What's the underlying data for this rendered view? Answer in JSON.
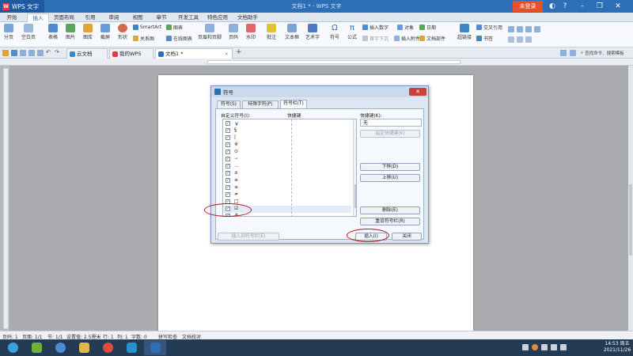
{
  "titlebar": {
    "app_name": "WPS 文字",
    "doc_title": "文档1 * - WPS 文字",
    "login": "未登录"
  },
  "menu": [
    "开始",
    "插入",
    "页面布局",
    "引用",
    "审阅",
    "视图",
    "章节",
    "开发工具",
    "特色应用",
    "文档助手"
  ],
  "ribbon": {
    "large": [
      "分页",
      "空白页",
      "表格",
      "图片",
      "图库",
      "截屏",
      "形状",
      "页眉和页脚",
      "页码",
      "水印",
      "批注",
      "文本框",
      "艺术字",
      "符号",
      "公式",
      "超链接",
      "书签"
    ],
    "small": [
      "SmartArt",
      "图表",
      "关系图",
      "在线图表",
      "插入数字",
      "对象",
      "日期",
      "首字下沉",
      "插入附件",
      "文档部件",
      "交叉引用"
    ]
  },
  "docbar": {
    "tabs": [
      "云文档",
      "我的WPS",
      "文档1 *"
    ],
    "search": "查找命令、搜索模板"
  },
  "statusbar": [
    "页码: 1",
    "页面: 1/1",
    "节: 1/1",
    "设置值: 2.5厘米",
    "行: 1",
    "列: 1",
    "字数: 0",
    "拼写检查",
    "文档校对"
  ],
  "clock": {
    "time": "14:53 周五",
    "date": "2021/11/26"
  },
  "dialog": {
    "title": "符号",
    "tabs": [
      "符号(S)",
      "特殊字符(P)",
      "符号栏(T)"
    ],
    "list_header": "自定义符号(I):",
    "shortcut_col": "快捷键",
    "shortcut_label": "快捷键(K):",
    "shortcut_value": "无",
    "symbols": [
      "￥",
      "§",
      "|",
      "※",
      "⊙",
      "∽",
      "…",
      "±",
      "≥",
      "≤",
      "≠",
      "□",
      "☑",
      "®"
    ],
    "selected_index": 12,
    "btn_assign": "指定快捷键(K)",
    "btn_down": "下移(D)",
    "btn_up": "上移(U)",
    "btn_delete": "删除(E)",
    "btn_reset": "重设符号栏(R)",
    "btn_insert_to_bar": "插入到符号栏(E)",
    "btn_insert": "插入(I)",
    "btn_close": "关闭"
  },
  "colors": {
    "accent": "#2c6fb7",
    "highlight_circle": "#b3161e"
  }
}
